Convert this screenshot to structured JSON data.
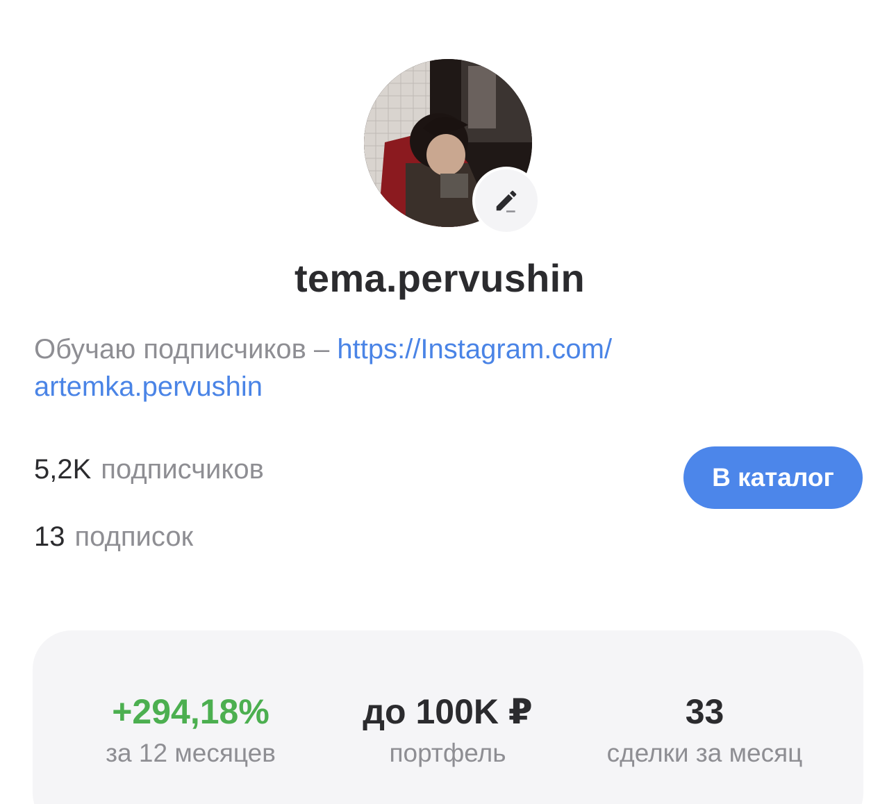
{
  "profile": {
    "username": "tema.pervushin",
    "avatar_alt": "profile photo",
    "bio_text": "Обучаю подписчиков – ",
    "bio_link": "https://Instagram.com/artemka.pervushin",
    "bio_link_line1": "https://Instagram.com/",
    "bio_link_line2": "artemka.pervushin"
  },
  "stats": {
    "followers_count": "5,2K",
    "followers_label": "подписчиков",
    "following_count": "13",
    "following_label": "подписок"
  },
  "actions": {
    "catalog_label": "В каталог"
  },
  "metrics": [
    {
      "value": "+294,18%",
      "label": "за 12 месяцев",
      "color": "#4caf50"
    },
    {
      "value": "до 100K ₽",
      "label": "портфель"
    },
    {
      "value": "33",
      "label": "сделки за месяц"
    }
  ],
  "colors": {
    "accent": "#4c86ea",
    "link": "#4a84e6",
    "positive": "#4caf50",
    "text_primary": "#2b2b2e",
    "text_secondary": "#8e8e93",
    "card_bg": "#f5f5f7"
  },
  "icons": {
    "edit": "pencil-icon"
  }
}
